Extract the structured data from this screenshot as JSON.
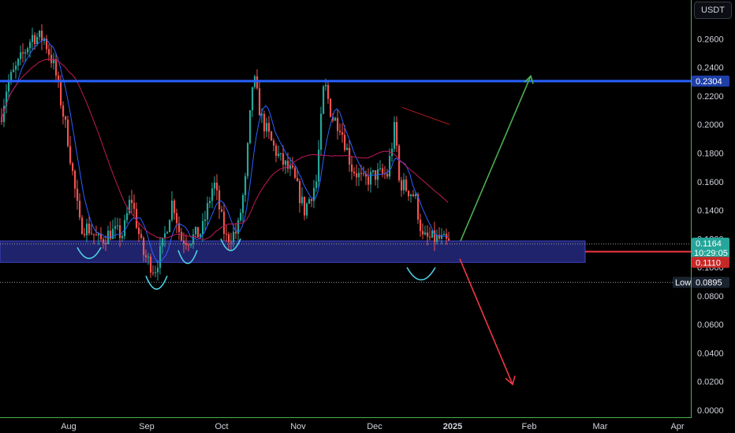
{
  "currency_button": "USDT",
  "chart_data": {
    "type": "candlestick",
    "y_ticks": [
      "0.2600",
      "0.2400",
      "0.2200",
      "0.2000",
      "0.1800",
      "0.1600",
      "0.1400",
      "0.1200",
      "0.1000",
      "0.0800",
      "0.0600",
      "0.0400",
      "0.0200",
      "0.0000"
    ],
    "ylim": [
      0,
      0.275
    ],
    "x_ticks": [
      "Aug",
      "Sep",
      "Oct",
      "Nov",
      "Dec",
      "2025",
      "Feb",
      "Mar",
      "Apr"
    ],
    "resistance_level": {
      "value": 0.2304,
      "label": "0.2304",
      "color": "#2962ff"
    },
    "current_price": {
      "value": 0.1164,
      "label": "0.1164",
      "countdown": "10:29:05",
      "color": "#26a69a"
    },
    "support_level": {
      "value": 0.111,
      "label": "0.1110",
      "color": "#f23645"
    },
    "low_marker": {
      "value": 0.0895,
      "caption": "Low",
      "label": "0.0895"
    },
    "support_zone": [
      0.1035,
      0.1185
    ],
    "projection_up": {
      "from": 0.1185,
      "to": 0.234,
      "color": "#4caf50"
    },
    "projection_down": {
      "from": 0.106,
      "to": 0.018,
      "color": "#f23645"
    },
    "colors": {
      "up": "#26a69a",
      "down": "#ef5350",
      "ma_fast": "#2962ff",
      "ma_slow": "#c2185b",
      "accent": "#4dd0e1",
      "zone": "#2a2f8f"
    }
  }
}
